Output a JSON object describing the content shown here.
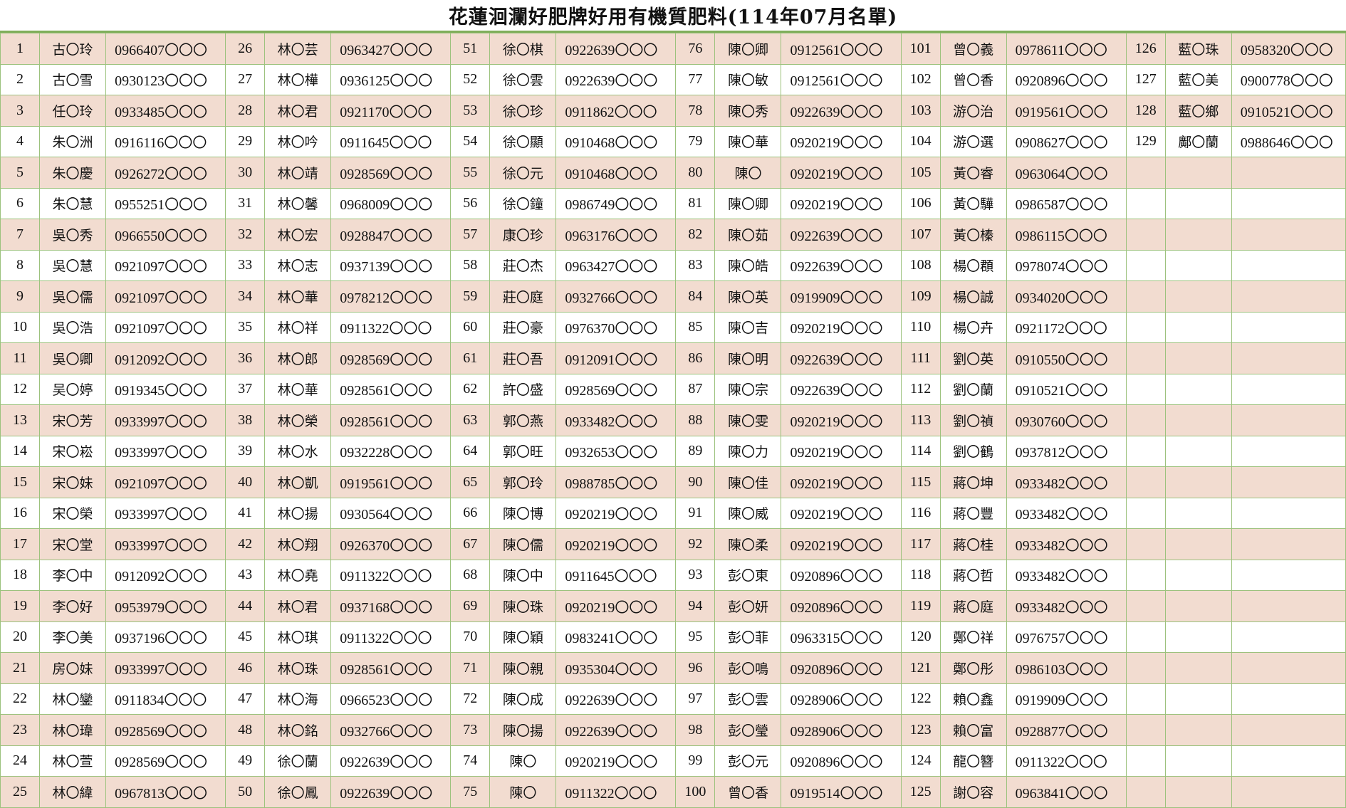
{
  "title": "花蓮洄瀾好肥牌好用有機質肥料(114年07月名單)",
  "colors": {
    "shaded_row": "#f2dcd0",
    "grid_line": "#9cc27d",
    "title_rule": "#7fae5a"
  },
  "entries": [
    {
      "no": "1",
      "name": "古〇玲",
      "phone": "0966407〇〇〇"
    },
    {
      "no": "2",
      "name": "古〇雪",
      "phone": "0930123〇〇〇"
    },
    {
      "no": "3",
      "name": "任〇玲",
      "phone": "0933485〇〇〇"
    },
    {
      "no": "4",
      "name": "朱〇洲",
      "phone": "0916116〇〇〇"
    },
    {
      "no": "5",
      "name": "朱〇慶",
      "phone": "0926272〇〇〇"
    },
    {
      "no": "6",
      "name": "朱〇慧",
      "phone": "0955251〇〇〇"
    },
    {
      "no": "7",
      "name": "吳〇秀",
      "phone": "0966550〇〇〇"
    },
    {
      "no": "8",
      "name": "吳〇慧",
      "phone": "0921097〇〇〇"
    },
    {
      "no": "9",
      "name": "吳〇儒",
      "phone": "0921097〇〇〇"
    },
    {
      "no": "10",
      "name": "吳〇浩",
      "phone": "0921097〇〇〇"
    },
    {
      "no": "11",
      "name": "吳〇卿",
      "phone": "0912092〇〇〇"
    },
    {
      "no": "12",
      "name": "吴〇婷",
      "phone": "0919345〇〇〇"
    },
    {
      "no": "13",
      "name": "宋〇芳",
      "phone": "0933997〇〇〇"
    },
    {
      "no": "14",
      "name": "宋〇崧",
      "phone": "0933997〇〇〇"
    },
    {
      "no": "15",
      "name": "宋〇妹",
      "phone": "0921097〇〇〇"
    },
    {
      "no": "16",
      "name": "宋〇榮",
      "phone": "0933997〇〇〇"
    },
    {
      "no": "17",
      "name": "宋〇堂",
      "phone": "0933997〇〇〇"
    },
    {
      "no": "18",
      "name": "李〇中",
      "phone": "0912092〇〇〇"
    },
    {
      "no": "19",
      "name": "李〇好",
      "phone": "0953979〇〇〇"
    },
    {
      "no": "20",
      "name": "李〇美",
      "phone": "0937196〇〇〇"
    },
    {
      "no": "21",
      "name": "房〇妹",
      "phone": "0933997〇〇〇"
    },
    {
      "no": "22",
      "name": "林〇鑾",
      "phone": "0911834〇〇〇"
    },
    {
      "no": "23",
      "name": "林〇瑋",
      "phone": "0928569〇〇〇"
    },
    {
      "no": "24",
      "name": "林〇萱",
      "phone": "0928569〇〇〇"
    },
    {
      "no": "25",
      "name": "林〇緯",
      "phone": "0967813〇〇〇"
    },
    {
      "no": "26",
      "name": "林〇芸",
      "phone": "0963427〇〇〇"
    },
    {
      "no": "27",
      "name": "林〇樺",
      "phone": "0936125〇〇〇"
    },
    {
      "no": "28",
      "name": "林〇君",
      "phone": "0921170〇〇〇"
    },
    {
      "no": "29",
      "name": "林〇吟",
      "phone": "0911645〇〇〇"
    },
    {
      "no": "30",
      "name": "林〇靖",
      "phone": "0928569〇〇〇"
    },
    {
      "no": "31",
      "name": "林〇馨",
      "phone": "0968009〇〇〇"
    },
    {
      "no": "32",
      "name": "林〇宏",
      "phone": "0928847〇〇〇"
    },
    {
      "no": "33",
      "name": "林〇志",
      "phone": "0937139〇〇〇"
    },
    {
      "no": "34",
      "name": "林〇華",
      "phone": "0978212〇〇〇"
    },
    {
      "no": "35",
      "name": "林〇祥",
      "phone": "0911322〇〇〇"
    },
    {
      "no": "36",
      "name": "林〇郎",
      "phone": "0928569〇〇〇"
    },
    {
      "no": "37",
      "name": "林〇華",
      "phone": "0928561〇〇〇"
    },
    {
      "no": "38",
      "name": "林〇榮",
      "phone": "0928561〇〇〇"
    },
    {
      "no": "39",
      "name": "林〇水",
      "phone": "0932228〇〇〇"
    },
    {
      "no": "40",
      "name": "林〇凱",
      "phone": "0919561〇〇〇"
    },
    {
      "no": "41",
      "name": "林〇揚",
      "phone": "0930564〇〇〇"
    },
    {
      "no": "42",
      "name": "林〇翔",
      "phone": "0926370〇〇〇"
    },
    {
      "no": "43",
      "name": "林〇堯",
      "phone": "0911322〇〇〇"
    },
    {
      "no": "44",
      "name": "林〇君",
      "phone": "0937168〇〇〇"
    },
    {
      "no": "45",
      "name": "林〇琪",
      "phone": "0911322〇〇〇"
    },
    {
      "no": "46",
      "name": "林〇珠",
      "phone": "0928561〇〇〇"
    },
    {
      "no": "47",
      "name": "林〇海",
      "phone": "0966523〇〇〇"
    },
    {
      "no": "48",
      "name": "林〇銘",
      "phone": "0932766〇〇〇"
    },
    {
      "no": "49",
      "name": "徐〇蘭",
      "phone": "0922639〇〇〇"
    },
    {
      "no": "50",
      "name": "徐〇鳳",
      "phone": "0922639〇〇〇"
    },
    {
      "no": "51",
      "name": "徐〇棋",
      "phone": "0922639〇〇〇"
    },
    {
      "no": "52",
      "name": "徐〇雲",
      "phone": "0922639〇〇〇"
    },
    {
      "no": "53",
      "name": "徐〇珍",
      "phone": "0911862〇〇〇"
    },
    {
      "no": "54",
      "name": "徐〇顯",
      "phone": "0910468〇〇〇"
    },
    {
      "no": "55",
      "name": "徐〇元",
      "phone": "0910468〇〇〇"
    },
    {
      "no": "56",
      "name": "徐〇鐘",
      "phone": "0986749〇〇〇"
    },
    {
      "no": "57",
      "name": "康〇珍",
      "phone": "0963176〇〇〇"
    },
    {
      "no": "58",
      "name": "莊〇杰",
      "phone": "0963427〇〇〇"
    },
    {
      "no": "59",
      "name": "莊〇庭",
      "phone": "0932766〇〇〇"
    },
    {
      "no": "60",
      "name": "莊〇豪",
      "phone": "0976370〇〇〇"
    },
    {
      "no": "61",
      "name": "莊〇吾",
      "phone": "0912091〇〇〇"
    },
    {
      "no": "62",
      "name": "許〇盛",
      "phone": "0928569〇〇〇"
    },
    {
      "no": "63",
      "name": "郭〇燕",
      "phone": "0933482〇〇〇"
    },
    {
      "no": "64",
      "name": "郭〇旺",
      "phone": "0932653〇〇〇"
    },
    {
      "no": "65",
      "name": "郭〇玲",
      "phone": "0988785〇〇〇"
    },
    {
      "no": "66",
      "name": "陳〇博",
      "phone": "0920219〇〇〇"
    },
    {
      "no": "67",
      "name": "陳〇儒",
      "phone": "0920219〇〇〇"
    },
    {
      "no": "68",
      "name": "陳〇中",
      "phone": "0911645〇〇〇"
    },
    {
      "no": "69",
      "name": "陳〇珠",
      "phone": "0920219〇〇〇"
    },
    {
      "no": "70",
      "name": "陳〇穎",
      "phone": "0983241〇〇〇"
    },
    {
      "no": "71",
      "name": "陳〇親",
      "phone": "0935304〇〇〇"
    },
    {
      "no": "72",
      "name": "陳〇成",
      "phone": "0922639〇〇〇"
    },
    {
      "no": "73",
      "name": "陳〇揚",
      "phone": "0922639〇〇〇"
    },
    {
      "no": "74",
      "name": "陳〇",
      "phone": "0920219〇〇〇"
    },
    {
      "no": "75",
      "name": "陳〇",
      "phone": "0911322〇〇〇"
    },
    {
      "no": "76",
      "name": "陳〇卿",
      "phone": "0912561〇〇〇"
    },
    {
      "no": "77",
      "name": "陳〇敏",
      "phone": "0912561〇〇〇"
    },
    {
      "no": "78",
      "name": "陳〇秀",
      "phone": "0922639〇〇〇"
    },
    {
      "no": "79",
      "name": "陳〇華",
      "phone": "0920219〇〇〇"
    },
    {
      "no": "80",
      "name": "陳〇",
      "phone": "0920219〇〇〇"
    },
    {
      "no": "81",
      "name": "陳〇卿",
      "phone": "0920219〇〇〇"
    },
    {
      "no": "82",
      "name": "陳〇茹",
      "phone": "0922639〇〇〇"
    },
    {
      "no": "83",
      "name": "陳〇皓",
      "phone": "0922639〇〇〇"
    },
    {
      "no": "84",
      "name": "陳〇英",
      "phone": "0919909〇〇〇"
    },
    {
      "no": "85",
      "name": "陳〇吉",
      "phone": "0920219〇〇〇"
    },
    {
      "no": "86",
      "name": "陳〇明",
      "phone": "0922639〇〇〇"
    },
    {
      "no": "87",
      "name": "陳〇宗",
      "phone": "0922639〇〇〇"
    },
    {
      "no": "88",
      "name": "陳〇雯",
      "phone": "0920219〇〇〇"
    },
    {
      "no": "89",
      "name": "陳〇力",
      "phone": "0920219〇〇〇"
    },
    {
      "no": "90",
      "name": "陳〇佳",
      "phone": "0920219〇〇〇"
    },
    {
      "no": "91",
      "name": "陳〇威",
      "phone": "0920219〇〇〇"
    },
    {
      "no": "92",
      "name": "陳〇柔",
      "phone": "0920219〇〇〇"
    },
    {
      "no": "93",
      "name": "彭〇東",
      "phone": "0920896〇〇〇"
    },
    {
      "no": "94",
      "name": "彭〇妍",
      "phone": "0920896〇〇〇"
    },
    {
      "no": "95",
      "name": "彭〇菲",
      "phone": "0963315〇〇〇"
    },
    {
      "no": "96",
      "name": "彭〇鳴",
      "phone": "0920896〇〇〇"
    },
    {
      "no": "97",
      "name": "彭〇雲",
      "phone": "0928906〇〇〇"
    },
    {
      "no": "98",
      "name": "彭〇瑩",
      "phone": "0928906〇〇〇"
    },
    {
      "no": "99",
      "name": "彭〇元",
      "phone": "0920896〇〇〇"
    },
    {
      "no": "100",
      "name": "曾〇香",
      "phone": "0919514〇〇〇"
    },
    {
      "no": "101",
      "name": "曾〇義",
      "phone": "0978611〇〇〇"
    },
    {
      "no": "102",
      "name": "曾〇香",
      "phone": "0920896〇〇〇"
    },
    {
      "no": "103",
      "name": "游〇治",
      "phone": "0919561〇〇〇"
    },
    {
      "no": "104",
      "name": "游〇選",
      "phone": "0908627〇〇〇"
    },
    {
      "no": "105",
      "name": "黃〇睿",
      "phone": "0963064〇〇〇"
    },
    {
      "no": "106",
      "name": "黃〇驊",
      "phone": "0986587〇〇〇"
    },
    {
      "no": "107",
      "name": "黃〇榛",
      "phone": "0986115〇〇〇"
    },
    {
      "no": "108",
      "name": "楊〇頵",
      "phone": "0978074〇〇〇"
    },
    {
      "no": "109",
      "name": "楊〇誠",
      "phone": "0934020〇〇〇"
    },
    {
      "no": "110",
      "name": "楊〇卉",
      "phone": "0921172〇〇〇"
    },
    {
      "no": "111",
      "name": "劉〇英",
      "phone": "0910550〇〇〇"
    },
    {
      "no": "112",
      "name": "劉〇蘭",
      "phone": "0910521〇〇〇"
    },
    {
      "no": "113",
      "name": "劉〇禎",
      "phone": "0930760〇〇〇"
    },
    {
      "no": "114",
      "name": "劉〇鶴",
      "phone": "0937812〇〇〇"
    },
    {
      "no": "115",
      "name": "蔣〇坤",
      "phone": "0933482〇〇〇"
    },
    {
      "no": "116",
      "name": "蔣〇豐",
      "phone": "0933482〇〇〇"
    },
    {
      "no": "117",
      "name": "蔣〇桂",
      "phone": "0933482〇〇〇"
    },
    {
      "no": "118",
      "name": "蔣〇哲",
      "phone": "0933482〇〇〇"
    },
    {
      "no": "119",
      "name": "蔣〇庭",
      "phone": "0933482〇〇〇"
    },
    {
      "no": "120",
      "name": "鄭〇祥",
      "phone": "0976757〇〇〇"
    },
    {
      "no": "121",
      "name": "鄭〇彤",
      "phone": "0986103〇〇〇"
    },
    {
      "no": "122",
      "name": "賴〇鑫",
      "phone": "0919909〇〇〇"
    },
    {
      "no": "123",
      "name": "賴〇富",
      "phone": "0928877〇〇〇"
    },
    {
      "no": "124",
      "name": "龍〇簪",
      "phone": "0911322〇〇〇"
    },
    {
      "no": "125",
      "name": "謝〇容",
      "phone": "0963841〇〇〇"
    },
    {
      "no": "126",
      "name": "藍〇珠",
      "phone": "0958320〇〇〇"
    },
    {
      "no": "127",
      "name": "藍〇美",
      "phone": "0900778〇〇〇"
    },
    {
      "no": "128",
      "name": "藍〇鄉",
      "phone": "0910521〇〇〇"
    },
    {
      "no": "129",
      "name": "鄺〇蘭",
      "phone": "0988646〇〇〇"
    }
  ]
}
